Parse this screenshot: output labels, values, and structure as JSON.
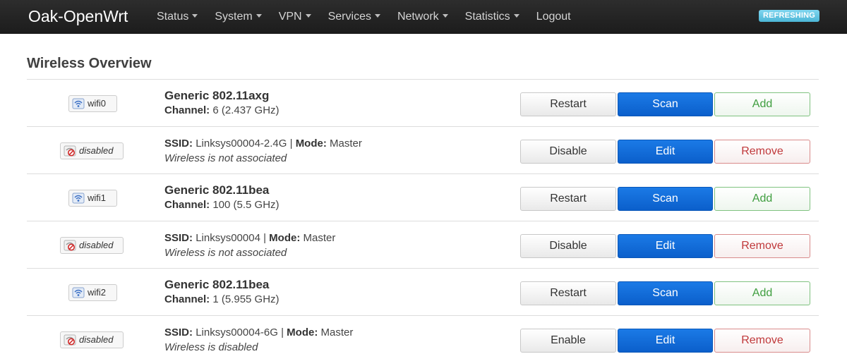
{
  "navbar": {
    "brand": "Oak-OpenWrt",
    "menu": [
      {
        "label": "Status",
        "dropdown": true
      },
      {
        "label": "System",
        "dropdown": true
      },
      {
        "label": "VPN",
        "dropdown": true
      },
      {
        "label": "Services",
        "dropdown": true
      },
      {
        "label": "Network",
        "dropdown": true
      },
      {
        "label": "Statistics",
        "dropdown": true
      },
      {
        "label": "Logout",
        "dropdown": false
      }
    ],
    "indicator": "REFRESHING"
  },
  "page": {
    "title": "Wireless Overview"
  },
  "colors": {
    "navbar_bg": "#222222",
    "indicator_bg": "#5bc0de",
    "primary_button": "#0b63ce",
    "positive_text": "#3f9e3f",
    "negative_text": "#c0393b"
  },
  "radios": [
    {
      "device": {
        "badge": "wifi0",
        "badge_icon": "wifi-device-icon",
        "hardware": "Generic 802.11axg",
        "channel_label": "Channel:",
        "channel_value": "6 (2.437 GHz)",
        "buttons": {
          "restart": "Restart",
          "scan": "Scan",
          "add": "Add"
        }
      },
      "network": {
        "badge": "disabled",
        "badge_icon": "wifi-disabled-icon",
        "ssid_label": "SSID:",
        "ssid": "Linksys00004-2.4G",
        "separator": "|",
        "mode_label": "Mode:",
        "mode": "Master",
        "association": "Wireless is not associated",
        "buttons": {
          "toggle": "Disable",
          "edit": "Edit",
          "remove": "Remove"
        }
      }
    },
    {
      "device": {
        "badge": "wifi1",
        "badge_icon": "wifi-device-icon",
        "hardware": "Generic 802.11bea",
        "channel_label": "Channel:",
        "channel_value": "100 (5.5 GHz)",
        "buttons": {
          "restart": "Restart",
          "scan": "Scan",
          "add": "Add"
        }
      },
      "network": {
        "badge": "disabled",
        "badge_icon": "wifi-disabled-icon",
        "ssid_label": "SSID:",
        "ssid": "Linksys00004",
        "separator": "|",
        "mode_label": "Mode:",
        "mode": "Master",
        "association": "Wireless is not associated",
        "buttons": {
          "toggle": "Disable",
          "edit": "Edit",
          "remove": "Remove"
        }
      }
    },
    {
      "device": {
        "badge": "wifi2",
        "badge_icon": "wifi-device-icon",
        "hardware": "Generic 802.11bea",
        "channel_label": "Channel:",
        "channel_value": "1 (5.955 GHz)",
        "buttons": {
          "restart": "Restart",
          "scan": "Scan",
          "add": "Add"
        }
      },
      "network": {
        "badge": "disabled",
        "badge_icon": "wifi-disabled-icon",
        "ssid_label": "SSID:",
        "ssid": "Linksys00004-6G",
        "separator": "|",
        "mode_label": "Mode:",
        "mode": "Master",
        "association": "Wireless is disabled",
        "buttons": {
          "toggle": "Enable",
          "edit": "Edit",
          "remove": "Remove"
        }
      }
    }
  ]
}
